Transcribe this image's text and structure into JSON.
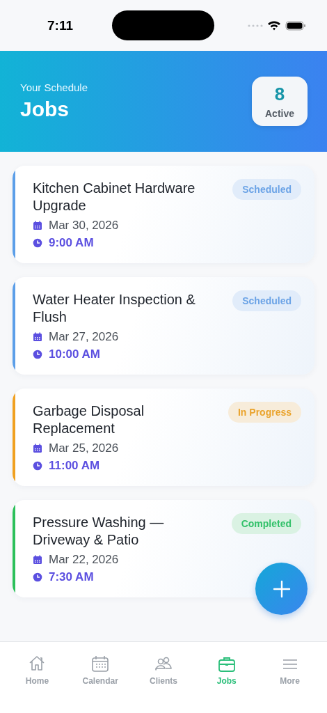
{
  "status_bar": {
    "time": "7:11"
  },
  "header": {
    "subtitle": "Your Schedule",
    "title": "Jobs",
    "count": "8",
    "count_label": "Active"
  },
  "jobs": [
    {
      "title": "Kitchen Cabinet Hardware Upgrade",
      "date": "Mar 30, 2026",
      "time": "9:00 AM",
      "status": "Scheduled",
      "kind": "scheduled",
      "color": "#5b9ee8"
    },
    {
      "title": "Water Heater Inspection & Flush",
      "date": "Mar 27, 2026",
      "time": "10:00 AM",
      "status": "Scheduled",
      "kind": "scheduled",
      "color": "#5b9ee8"
    },
    {
      "title": "Garbage Disposal Replacement",
      "date": "Mar 25, 2026",
      "time": "11:00 AM",
      "status": "In Progress",
      "kind": "in_progress",
      "color": "#f0a020"
    },
    {
      "title": "Pressure Washing — Driveway & Patio",
      "date": "Mar 22, 2026",
      "time": "7:30 AM",
      "status": "Completed",
      "kind": "completed",
      "color": "#2cc05a"
    }
  ],
  "tabs": [
    {
      "label": "Home",
      "kind": "home",
      "selected": false
    },
    {
      "label": "Calendar",
      "kind": "calendar",
      "selected": false
    },
    {
      "label": "Clients",
      "kind": "clients",
      "selected": false
    },
    {
      "label": "Jobs",
      "kind": "jobs",
      "selected": true
    },
    {
      "label": "More",
      "kind": "more",
      "selected": false
    }
  ]
}
